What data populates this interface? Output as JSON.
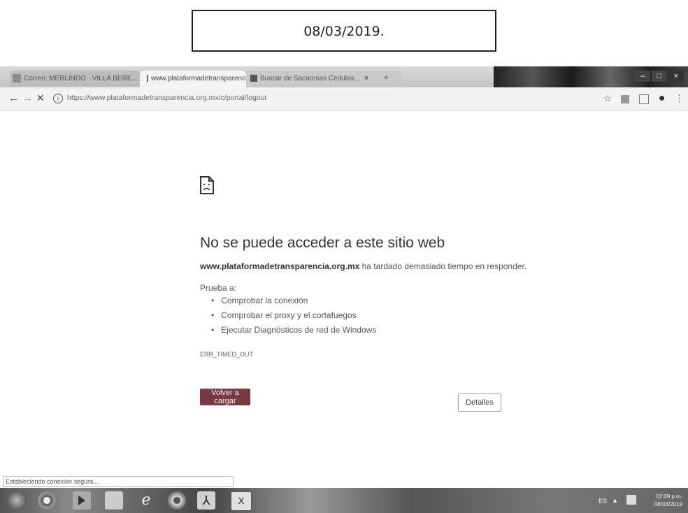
{
  "stamp": {
    "date": "08/03/2019."
  },
  "browser": {
    "tabs": [
      {
        "label": "Correo: MERLINDO · VILLA BERE...",
        "close": "×"
      },
      {
        "label": "www.plataformadetransparencia",
        "close": "×"
      },
      {
        "label": "Buscar de Sacarosas Cédulas...",
        "close": "×"
      }
    ],
    "new_tab": "+",
    "window_buttons": {
      "minimize": "–",
      "maximize": "□",
      "close": "×"
    },
    "url": "https://www.plataformadetransparencia.org.mx/c/portal/logout",
    "nav": {
      "back": "←",
      "forward": "→",
      "stop": "✕"
    }
  },
  "error": {
    "title": "No se puede acceder a este sitio web",
    "host": "www.plataformadetransparencia.org.mx",
    "desc_rest": " ha tardado demasiado tiempo en responder.",
    "try_label": "Prueba a:",
    "suggestions": [
      "Comprobar la conexión",
      "Comprobar el proxy y el cortafuegos",
      "Ejecutar Diagnósticos de red de Windows"
    ],
    "code": "ERR_TIMED_OUT",
    "reload_label": "Volver a cargar",
    "details_label": "Detalles"
  },
  "status_text": "Estableciendo conexión segura...",
  "taskbar": {
    "lang": "ES",
    "arrow": "▲",
    "time": "02:09 p.m.",
    "date": "08/03/2019"
  },
  "icons": {
    "star": "☆",
    "profile": "●",
    "menu": "⋮",
    "pdf": "⅄",
    "excel": "X"
  }
}
